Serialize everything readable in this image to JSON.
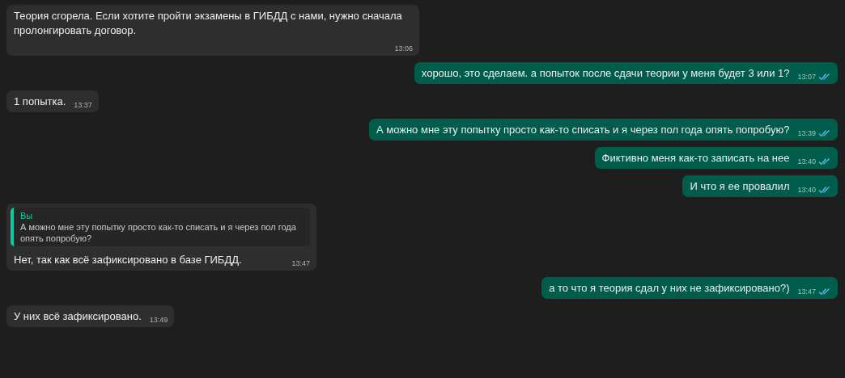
{
  "messages": [
    {
      "outgoing": false,
      "text": "Теория сгорела. Если хотите пройти экзамены в ГИБДД с нами, нужно сначала пролонгировать договор.",
      "time": "13:06"
    },
    {
      "outgoing": true,
      "text": "хорошо, это сделаем. а попыток после сдачи теории у меня будет 3 или 1?",
      "time": "13:07",
      "read": true
    },
    {
      "outgoing": false,
      "text": "1 попытка.",
      "time": "13:37"
    },
    {
      "outgoing": true,
      "text": "А можно мне эту попытку просто как-то списать и я через пол года опять попробую?",
      "time": "13:39",
      "read": true
    },
    {
      "outgoing": true,
      "text": "Фиктивно меня как-то записать на нее",
      "time": "13:40",
      "read": true
    },
    {
      "outgoing": true,
      "text": "И что я ее провалил",
      "time": "13:40",
      "read": true
    },
    {
      "outgoing": false,
      "quote": {
        "sender": "Вы",
        "text": "А можно мне эту попытку просто как-то списать и я через пол года опять попробую?"
      },
      "text": "Нет, так как всё зафиксировано в базе ГИБДД.",
      "time": "13:47"
    },
    {
      "outgoing": true,
      "text": "а то что я теория сдал у них не зафиксировано?)",
      "time": "13:47",
      "read": true
    },
    {
      "outgoing": false,
      "text": "У них всё зафиксировано.",
      "time": "13:49"
    }
  ]
}
